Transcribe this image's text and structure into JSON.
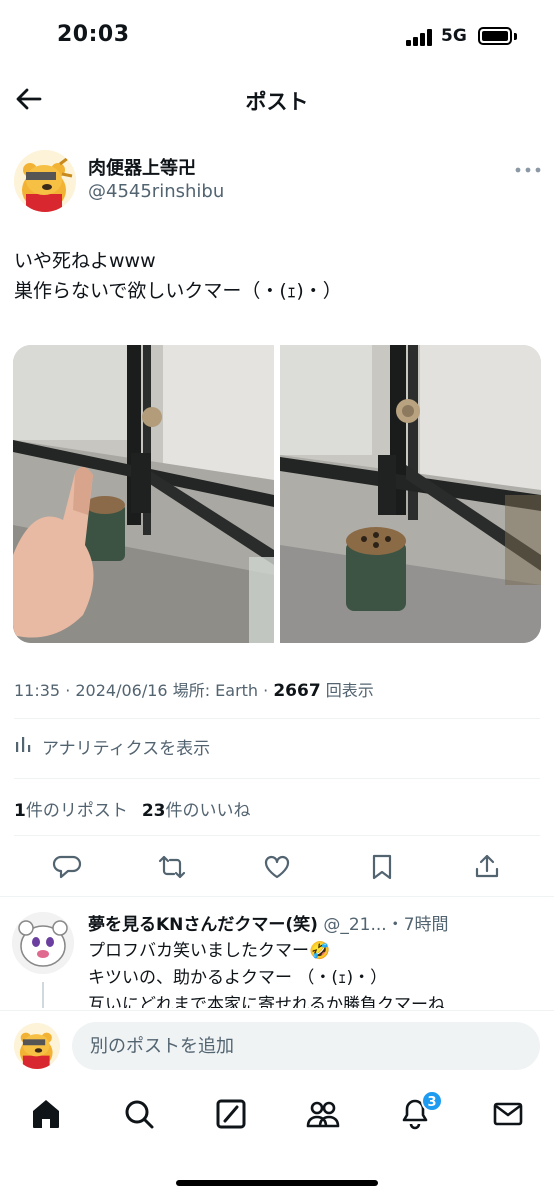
{
  "status_bar": {
    "time": "20:03",
    "network": "5G"
  },
  "header": {
    "title": "ポスト"
  },
  "post": {
    "author_name": "肉便器上等卍",
    "author_handle": "@4545rinshibu",
    "text": "いや死ねよwww\n巣作らないで欲しいクマー（・(ｪ)・）",
    "meta": {
      "time": "11:35",
      "date": "2024/06/16",
      "location_label": "場所: Earth",
      "views_count": "2667",
      "views_label": "回表示"
    },
    "analytics_label": "アナリティクスを表示",
    "stats": {
      "reposts_count": "1",
      "reposts_label": "件のリポスト",
      "likes_count": "23",
      "likes_label": "件のいいね"
    }
  },
  "reply": {
    "author_name": "夢を見るKNさんだクマー(笑)",
    "author_handle": "@_21...",
    "time_ago": "・7時間",
    "text": "プロフバカ笑いましたクマー🤣\nキツいの、助かるよクマー （・(ｪ)・）\n互いにどれまで本家に寄せれるか勝負クマーね"
  },
  "compose": {
    "placeholder": "別のポストを追加"
  },
  "tab_bar": {
    "items": [
      "home-icon",
      "search-icon",
      "grok-icon",
      "communities-icon",
      "notifications-icon",
      "messages-icon"
    ],
    "notification_badge": "3"
  },
  "colors": {
    "accent": "#1d9bf0",
    "text": "#0f1419",
    "secondary": "#536471"
  }
}
